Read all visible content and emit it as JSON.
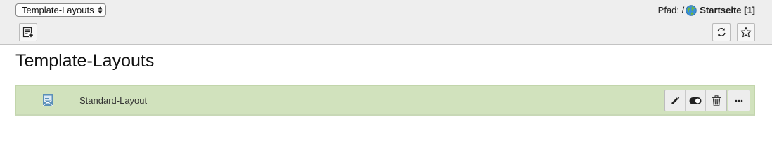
{
  "header": {
    "module_select": {
      "selected": "Template-Layouts"
    },
    "path": {
      "label": "Pfad: /",
      "page_title": "Startseite [1]",
      "page_icon": "globe-icon"
    },
    "buttons": {
      "new_record_icon": "new-record-icon",
      "reload_icon": "reload-icon",
      "bookmark_icon": "star-icon"
    }
  },
  "main": {
    "title": "Template-Layouts",
    "layouts": [
      {
        "label": "Standard-Layout",
        "icon": "template-layout-icon",
        "row_color": "#d1e2bd",
        "actions": [
          "edit-icon",
          "toggle-icon",
          "delete-icon",
          "more-icon"
        ]
      }
    ]
  }
}
